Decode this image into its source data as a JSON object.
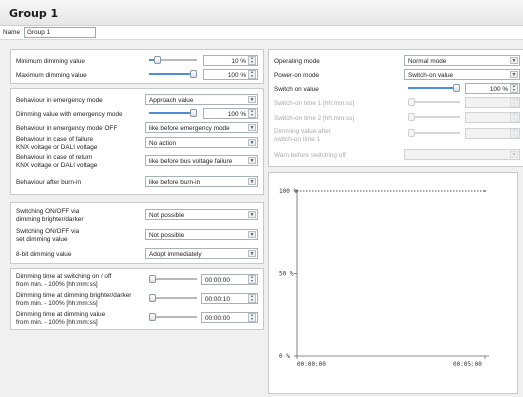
{
  "window": {
    "title": "Group 1"
  },
  "name_field": {
    "label": "Name",
    "value": "Group 1"
  },
  "left_top": {
    "min_dimming": {
      "label": "Minimum dimming value",
      "value": "10 %",
      "fraction": 0.12
    },
    "max_dimming": {
      "label": "Maximum dimming value",
      "value": "100 %",
      "fraction": 1.0
    }
  },
  "emergency": {
    "behaviour_emergency": {
      "label": "Behaviour in emergency mode",
      "value": "Approach value"
    },
    "dimming_emergency": {
      "label": "Dimming value with emergency mode",
      "value": "100 %",
      "fraction": 1.0
    },
    "behaviour_emergency_off": {
      "label": "Behaviour in emergency mode OFF",
      "value": "like before emergency mode"
    },
    "failure": {
      "label1": "Behaviour in case of failure",
      "label2": "KNX voltage or DALI voltage",
      "value": "No action"
    },
    "return": {
      "label1": "Behaviour in case of return",
      "label2": "KNX voltage or DALI voltage",
      "value": "like before bus voltage failure"
    },
    "burn_in": {
      "label": "Behaviour after burn-in",
      "value": "like before burn-in"
    }
  },
  "switching": {
    "onoff_dimming": {
      "label1": "Switching ON/OFF via",
      "label2": "dimming brighter/darker",
      "value": "Not possible"
    },
    "onoff_set": {
      "label1": "Switching ON/OFF via",
      "label2": "set dimming value",
      "value": "Not possible"
    },
    "eight_bit": {
      "label": "8-bit dimming value",
      "value": "Adopt immediately"
    }
  },
  "times": {
    "switch_on_off": {
      "label1": "Dimming time at switching on / off",
      "label2": "from min. - 100% [hh:mm:ss]",
      "value": "00:00:00",
      "fraction": 0.0
    },
    "brighter_darker": {
      "label1": "Dimming time at dimming brighter/darker",
      "label2": "from min. - 100% [hh:mm:ss]",
      "value": "00:00:10",
      "fraction": 0.0
    },
    "dimming_value": {
      "label1": "Dimming time at dimming value",
      "label2": "from min. - 100% [hh:mm:ss]",
      "value": "00:00:00",
      "fraction": 0.0
    }
  },
  "right": {
    "operating_mode": {
      "label": "Operating mode",
      "value": "Normal mode"
    },
    "power_on_mode": {
      "label": "Power-on mode",
      "value": "Switch-on value"
    },
    "switch_on_value": {
      "label": "Switch on value",
      "value": "100 %",
      "fraction": 1.0
    },
    "switch_on_time1": {
      "label": "Switch-on time 1 [hh:mm:ss]"
    },
    "switch_on_time2": {
      "label": "Switch-on time 2 [hh:mm:ss]"
    },
    "dimming_after": {
      "label1": "Dimming value after",
      "label2": "switch-on time 1"
    },
    "warn": {
      "label": "Warn before switching off"
    }
  },
  "chart_data": {
    "type": "line",
    "x": [
      "00:00:00",
      "00:05:00"
    ],
    "values": [
      100,
      100
    ],
    "y_ticks": [
      "100 %",
      "50 %",
      "0 %"
    ],
    "x_ticks": [
      "00:00:00",
      "00:05:00"
    ],
    "ylim": [
      0,
      100
    ]
  }
}
